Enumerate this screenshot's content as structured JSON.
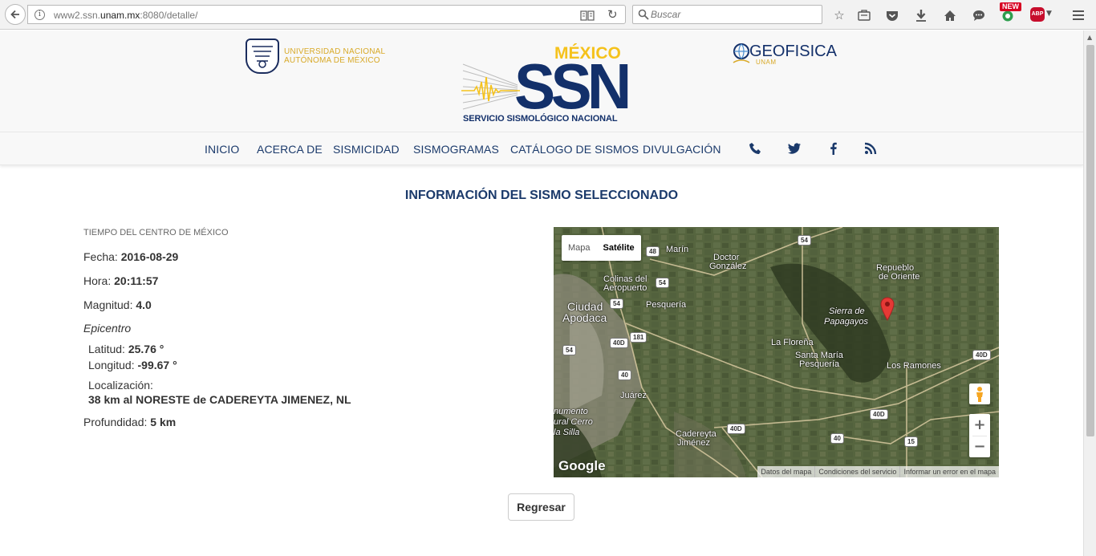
{
  "browser": {
    "url_prefix": "www2.ssn.",
    "url_domain": "unam.mx",
    "url_suffix": ":8080/detalle/",
    "search_placeholder": "Buscar",
    "new_badge": "NEW",
    "abp_label": "ABP"
  },
  "header": {
    "unam_line1": "UNIVERSIDAD NACIONAL",
    "unam_line2": "AUTÓNOMA DE MÉXICO",
    "ssn_country": "MÉXICO",
    "ssn_acronym": "SSN",
    "ssn_full": "SERVICIO SISMOLÓGICO NACIONAL",
    "geo_name": "GEOFISICA",
    "geo_sub": "UNAM"
  },
  "nav": {
    "items": [
      "INICIO",
      "ACERCA DE",
      "SISMICIDAD",
      "SISMOGRAMAS",
      "CATÁLOGO DE SISMOS",
      "DIVULGACIÓN"
    ]
  },
  "page": {
    "title": "INFORMACIÓN DEL SISMO SELECCIONADO"
  },
  "quake": {
    "tz_label": "TIEMPO DEL CENTRO DE MÉXICO",
    "fecha_label": "Fecha: ",
    "fecha": "2016-08-29",
    "hora_label": "Hora: ",
    "hora": "20:11:57",
    "magnitud_label": "Magnitud: ",
    "magnitud": "4.0",
    "epicentro_label": "Epicentro",
    "latitud_label": "Latitud: ",
    "latitud": "25.76 °",
    "longitud_label": "Longitud: ",
    "longitud": "-99.67 °",
    "localizacion_label": "Localización:",
    "localizacion": "38 km al NORESTE de CADEREYTA JIMENEZ, NL",
    "profundidad_label": "Profundidad: ",
    "profundidad": "5 km"
  },
  "map": {
    "type_options": [
      "Mapa",
      "Satélite"
    ],
    "selected_type": "Satélite",
    "zoom_in": "+",
    "zoom_out": "−",
    "google": "Google",
    "footer": [
      "Datos del mapa",
      "Condiciones del servicio",
      "Informar un error en el mapa"
    ],
    "labels": {
      "marin": "Marín",
      "doctor_gonzalez_1": "Doctor",
      "doctor_gonzalez_2": "González",
      "repueblo_1": "Repueblo",
      "repueblo_2": "de Oriente",
      "colinas_1": "Colinas del",
      "colinas_2": "Aeropuerto",
      "ciudad_apodaca_1": "Ciudad",
      "ciudad_apodaca_2": "Apodaca",
      "pesqueria": "Pesquería",
      "sierra_1": "Sierra de",
      "sierra_2": "Papagayos",
      "la_florena": "La Floreña",
      "santa_maria_1": "Santa María",
      "santa_maria_2": "Pesquería",
      "los_ramones": "Los Ramones",
      "juarez": "Juárez",
      "monumento_1": "numento",
      "monumento_2": "ural Cerro",
      "monumento_3": "la Silla",
      "cadereyta_1": "Cadereyta",
      "cadereyta_2": "Jiménez"
    },
    "shields": {
      "s54_top": "54",
      "s48": "48",
      "s54_a": "54",
      "s54_b": "54",
      "s181": "181",
      "s40d_a": "40D",
      "s54_c": "54",
      "s40_a": "40",
      "s40d_b": "40D",
      "s40d_c": "40D",
      "s40d_d": "40D",
      "s40_b": "40",
      "s15": "15"
    }
  },
  "actions": {
    "back_label": "Regresar"
  },
  "colors": {
    "brand_navy": "#1b3a6b",
    "brand_gold": "#f5c21c",
    "map_pin": "#e53935"
  }
}
